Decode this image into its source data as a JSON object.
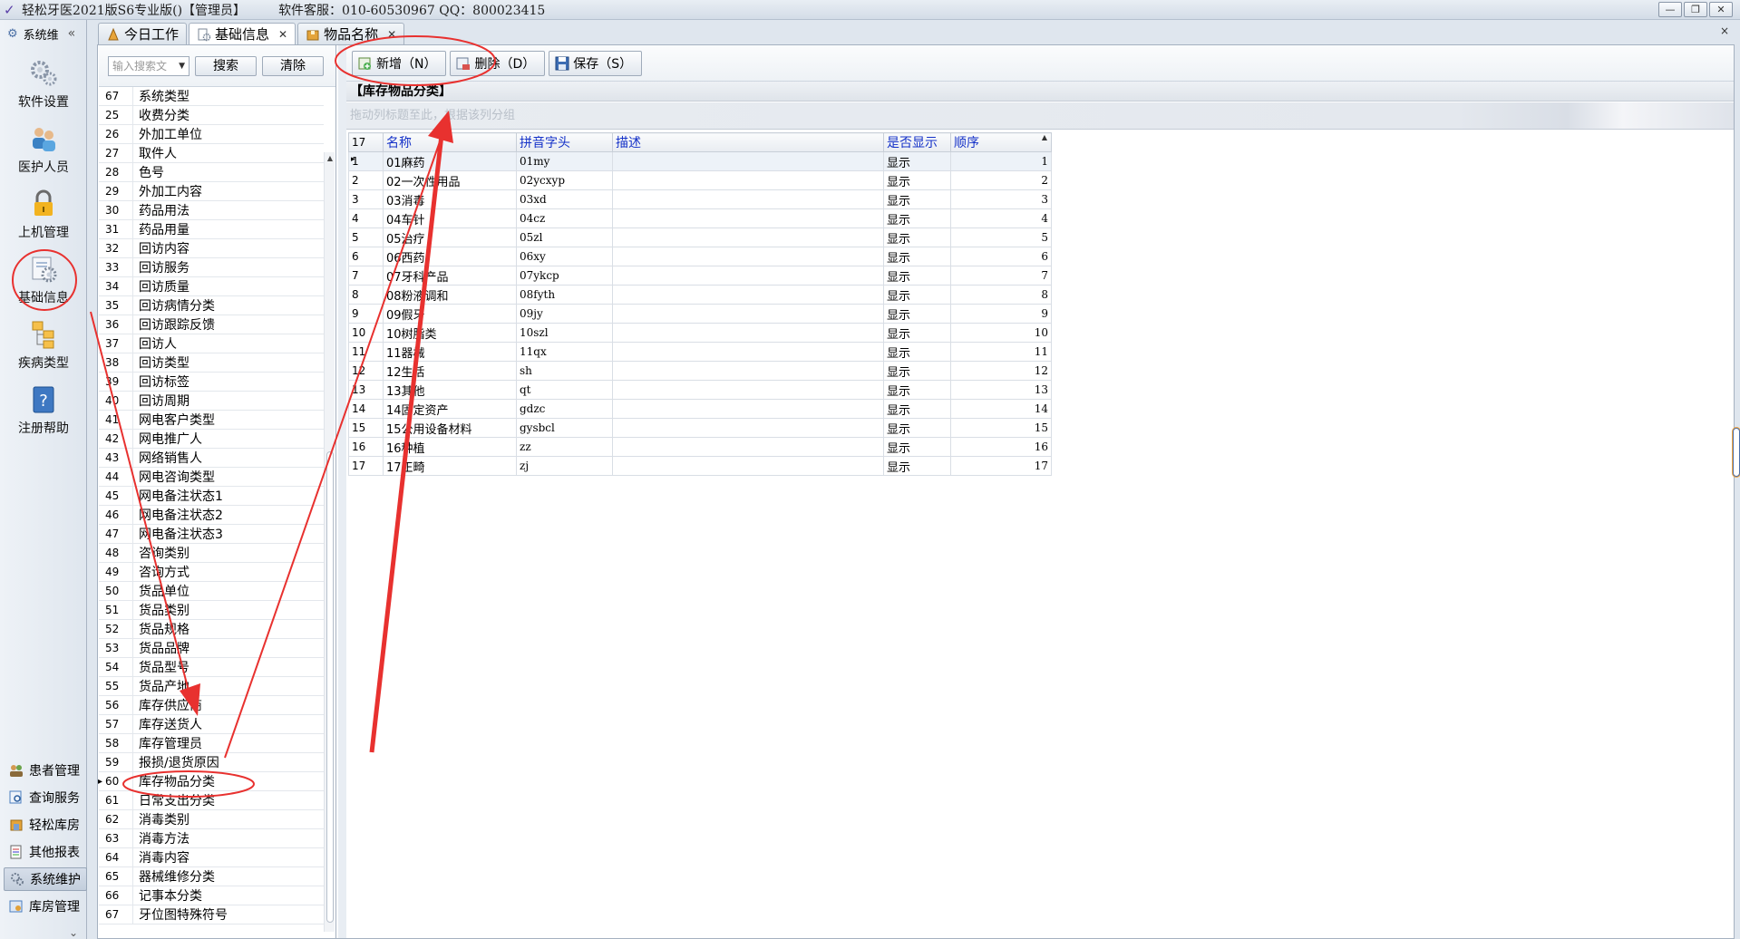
{
  "window": {
    "title": "轻松牙医2021版S6专业版()【管理员】",
    "service": "软件客服：010-60530967 QQ：800023415",
    "controls": [
      "minimize-icon",
      "restore-icon",
      "close-icon"
    ]
  },
  "nav": {
    "header": "系统维",
    "collapse": "«",
    "big_items": [
      {
        "label": "软件设置",
        "icon": "gear-icon"
      },
      {
        "label": "医护人员",
        "icon": "staff-icon"
      },
      {
        "label": "上机管理",
        "icon": "lock-icon"
      },
      {
        "label": "基础信息",
        "icon": "settings-info-icon"
      },
      {
        "label": "疾病类型",
        "icon": "tree-icon"
      },
      {
        "label": "注册帮助",
        "icon": "help-icon"
      }
    ],
    "small_items": [
      {
        "label": "患者管理",
        "icon": "patients-icon"
      },
      {
        "label": "查询服务",
        "icon": "query-icon"
      },
      {
        "label": "轻松库房",
        "icon": "warehouse-icon"
      },
      {
        "label": "其他报表",
        "icon": "report-icon"
      },
      {
        "label": "系统维护",
        "icon": "maintenance-icon"
      },
      {
        "label": "库房管理",
        "icon": "storage-icon"
      }
    ],
    "more": "⌄"
  },
  "tabs": [
    {
      "label": "今日工作",
      "closable": false
    },
    {
      "label": "基础信息",
      "closable": true
    },
    {
      "label": "物品名称",
      "closable": true
    }
  ],
  "close_all": "×",
  "list": {
    "search_placeholder": "输入搜索文",
    "search_button": "搜索",
    "clear_button": "清除",
    "rows": [
      {
        "num": "67",
        "name": "系统类型"
      },
      {
        "num": "25",
        "name": "收费分类"
      },
      {
        "num": "26",
        "name": "外加工单位"
      },
      {
        "num": "27",
        "name": "取件人"
      },
      {
        "num": "28",
        "name": "色号"
      },
      {
        "num": "29",
        "name": "外加工内容"
      },
      {
        "num": "30",
        "name": "药品用法"
      },
      {
        "num": "31",
        "name": "药品用量"
      },
      {
        "num": "32",
        "name": "回访内容"
      },
      {
        "num": "33",
        "name": "回访服务"
      },
      {
        "num": "34",
        "name": "回访质量"
      },
      {
        "num": "35",
        "name": "回访病情分类"
      },
      {
        "num": "36",
        "name": "回访跟踪反馈"
      },
      {
        "num": "37",
        "name": "回访人"
      },
      {
        "num": "38",
        "name": "回访类型"
      },
      {
        "num": "39",
        "name": "回访标签"
      },
      {
        "num": "40",
        "name": "回访周期"
      },
      {
        "num": "41",
        "name": "网电客户类型"
      },
      {
        "num": "42",
        "name": "网电推广人"
      },
      {
        "num": "43",
        "name": "网络销售人"
      },
      {
        "num": "44",
        "name": "网电咨询类型"
      },
      {
        "num": "45",
        "name": "网电备注状态1"
      },
      {
        "num": "46",
        "name": "网电备注状态2"
      },
      {
        "num": "47",
        "name": "网电备注状态3"
      },
      {
        "num": "48",
        "name": "咨询类别"
      },
      {
        "num": "49",
        "name": "咨询方式"
      },
      {
        "num": "50",
        "name": "货品单位"
      },
      {
        "num": "51",
        "name": "货品类别"
      },
      {
        "num": "52",
        "name": "货品规格"
      },
      {
        "num": "53",
        "name": "货品品牌"
      },
      {
        "num": "54",
        "name": "货品型号"
      },
      {
        "num": "55",
        "name": "货品产地"
      },
      {
        "num": "56",
        "name": "库存供应商"
      },
      {
        "num": "57",
        "name": "库存送货人"
      },
      {
        "num": "58",
        "name": "库存管理员"
      },
      {
        "num": "59",
        "name": "报损/退货原因"
      },
      {
        "num": "60",
        "name": "库存物品分类"
      },
      {
        "num": "61",
        "name": "日常支出分类"
      },
      {
        "num": "62",
        "name": "消毒类别"
      },
      {
        "num": "63",
        "name": "消毒方法"
      },
      {
        "num": "64",
        "name": "消毒内容"
      },
      {
        "num": "65",
        "name": "器械维修分类"
      },
      {
        "num": "66",
        "name": "记事本分类"
      },
      {
        "num": "67",
        "name": "牙位图特殊符号"
      }
    ],
    "selected_num": "60",
    "scroll_up": "▲"
  },
  "grid": {
    "toolbar": {
      "add": "新增（N）",
      "delete": "删除（D）",
      "save": "保存（S）"
    },
    "caption": "【库存物品分类】",
    "group_hint": "拖动列标题至此，根据该列分组",
    "row_count": "17",
    "columns": [
      "名称",
      "拼音字头",
      "描述",
      "是否显示",
      "顺序"
    ],
    "sort_indicator": "▲",
    "rows": [
      {
        "n": "1",
        "name": "01麻药",
        "py": "01my",
        "desc": "",
        "show": "显示",
        "order": "1"
      },
      {
        "n": "2",
        "name": "02一次性用品",
        "py": "02ycxyp",
        "desc": "",
        "show": "显示",
        "order": "2"
      },
      {
        "n": "3",
        "name": "03消毒",
        "py": "03xd",
        "desc": "",
        "show": "显示",
        "order": "3"
      },
      {
        "n": "4",
        "name": "04车针",
        "py": "04cz",
        "desc": "",
        "show": "显示",
        "order": "4"
      },
      {
        "n": "5",
        "name": "05治疗",
        "py": "05zl",
        "desc": "",
        "show": "显示",
        "order": "5"
      },
      {
        "n": "6",
        "name": "06西药",
        "py": "06xy",
        "desc": "",
        "show": "显示",
        "order": "6"
      },
      {
        "n": "7",
        "name": "07牙科产品",
        "py": "07ykcp",
        "desc": "",
        "show": "显示",
        "order": "7"
      },
      {
        "n": "8",
        "name": "08粉液调和",
        "py": "08fyth",
        "desc": "",
        "show": "显示",
        "order": "8"
      },
      {
        "n": "9",
        "name": "09假牙",
        "py": "09jy",
        "desc": "",
        "show": "显示",
        "order": "9"
      },
      {
        "n": "10",
        "name": "10树脂类",
        "py": "10szl",
        "desc": "",
        "show": "显示",
        "order": "10"
      },
      {
        "n": "11",
        "name": "11器械",
        "py": "11qx",
        "desc": "",
        "show": "显示",
        "order": "11"
      },
      {
        "n": "12",
        "name": "12生活",
        "py": "sh",
        "desc": "",
        "show": "显示",
        "order": "12"
      },
      {
        "n": "13",
        "name": "13其他",
        "py": "qt",
        "desc": "",
        "show": "显示",
        "order": "13"
      },
      {
        "n": "14",
        "name": "14固定资产",
        "py": "gdzc",
        "desc": "",
        "show": "显示",
        "order": "14"
      },
      {
        "n": "15",
        "name": "15公用设备材料",
        "py": "gysbcl",
        "desc": "",
        "show": "显示",
        "order": "15"
      },
      {
        "n": "16",
        "name": "16种植",
        "py": "zz",
        "desc": "",
        "show": "显示",
        "order": "16"
      },
      {
        "n": "17",
        "name": "17正畸",
        "py": "zj",
        "desc": "",
        "show": "显示",
        "order": "17"
      }
    ]
  },
  "colors": {
    "annotation_red": "#e8312f",
    "header_blue": "#1431c8",
    "panel_bg": "#dfe6ee"
  }
}
